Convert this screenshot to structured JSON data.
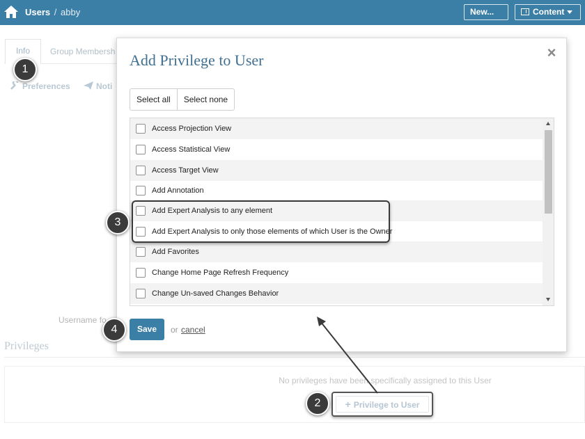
{
  "header": {
    "breadcrumb_root": "Users",
    "breadcrumb_sep": "/",
    "breadcrumb_user": "abby",
    "new_label": "New...",
    "content_label": "Content"
  },
  "background": {
    "tab_info": "Info",
    "tab_group": "Group Membersh",
    "preferences_label": "Preferences",
    "notifications_label": "Noti",
    "username_label": "Username fo",
    "privileges_heading": "Privileges",
    "no_privileges_text": "No privileges have been specifically assigned to this User",
    "add_privilege_label": "Privilege to User"
  },
  "modal": {
    "title": "Add Privilege to User",
    "select_all": "Select all",
    "select_none": "Select none",
    "privileges": [
      {
        "label": "Access Projection View",
        "checked": false
      },
      {
        "label": "Access Statistical View",
        "checked": false
      },
      {
        "label": "Access Target View",
        "checked": false
      },
      {
        "label": "Add Annotation",
        "checked": false
      },
      {
        "label": "Add Expert Analysis to any element",
        "checked": false
      },
      {
        "label": "Add Expert Analysis to only those elements of which User is the Owner",
        "checked": false
      },
      {
        "label": "Add Favorites",
        "checked": false
      },
      {
        "label": "Change Home Page Refresh Frequency",
        "checked": false
      },
      {
        "label": "Change Un-saved Changes Behavior",
        "checked": false
      }
    ],
    "save_label": "Save",
    "or_text": "or",
    "cancel_label": "cancel"
  },
  "callouts": {
    "step1": "1",
    "step2": "2",
    "step3": "3",
    "step4": "4"
  },
  "colors": {
    "brand": "#3c7fa6",
    "title": "#3f6f91",
    "callout": "#3b3b3b"
  }
}
